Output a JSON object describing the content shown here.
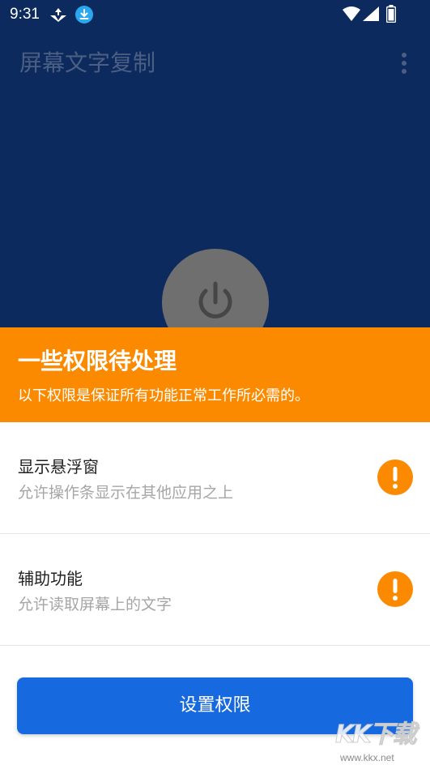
{
  "status_bar": {
    "time": "9:31",
    "icons": [
      "app-notification-icon",
      "download-icon",
      "wifi-icon",
      "signal-icon",
      "battery-icon"
    ]
  },
  "app_bar": {
    "title": "屏幕文字复制",
    "menu_icon": "more-vertical-icon"
  },
  "power": {
    "icon": "power-icon",
    "state": "off"
  },
  "sheet": {
    "title": "一些权限待处理",
    "subtitle": "以下权限是保证所有功能正常工作所必需的。",
    "permissions": [
      {
        "title": "显示悬浮窗",
        "description": "允许操作条显示在其他应用之上",
        "status_icon": "warning-icon"
      },
      {
        "title": "辅助功能",
        "description": "允许读取屏幕上的文字",
        "status_icon": "warning-icon"
      }
    ],
    "button_label": "设置权限"
  },
  "watermark": {
    "logo_text": "KK下载",
    "url": "www.kkx.net"
  },
  "colors": {
    "background": "#0c2a5e",
    "header_orange": "#fc8a00",
    "button_blue": "#1769e0",
    "power_gray": "#6f6f6f"
  }
}
